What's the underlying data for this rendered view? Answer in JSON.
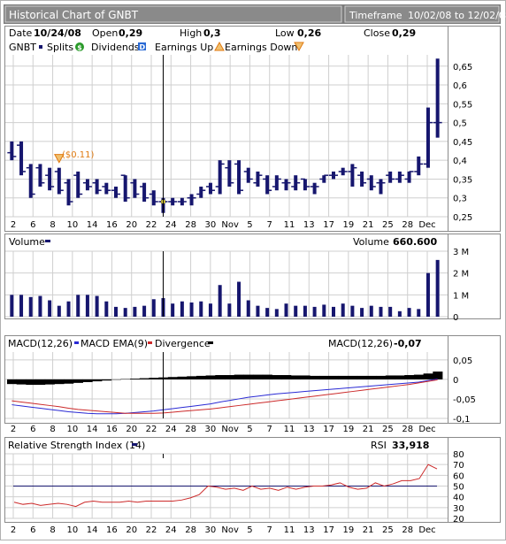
{
  "header": {
    "title": "Historical Chart of GNBT",
    "timeframe_label": "Timeframe",
    "timeframe_range": "10/02/08 to 12/02/08"
  },
  "info": {
    "date_label": "Date",
    "date_value": "10/24/08",
    "open_label": "Open",
    "open_value": "0,29",
    "high_label": "High",
    "high_value": "0,3",
    "low_label": "Low",
    "low_value": "0,26",
    "close_label": "Close",
    "close_value": "0,29"
  },
  "legend": {
    "symbol": "GNBT",
    "splits": "Splits",
    "dividends": "Dividends",
    "earnings_up": "Earnings Up",
    "earnings_down": "Earnings Down"
  },
  "colors": {
    "bar": "#16166e",
    "panel_bg": "#ffffff",
    "grid": "#cfcfcf",
    "frame": "#8a8a8a",
    "header_bg": "#7b7b7b",
    "header_text": "#ffffff",
    "macd_ema": "#2a2ad4",
    "divergence": "#cc2a2a",
    "rsi_line": "#cc2a2a",
    "rsi_ref": "#16166e",
    "earnings": "#e07a10",
    "crosshair": "#000000",
    "highlight": "#f0e040"
  },
  "icons": {
    "dividend": "dollar-circle-icon",
    "earnings_up": "earnings-up-triangle-icon",
    "earnings_down": "earnings-down-triangle-icon",
    "split": "split-square-icon"
  },
  "annotations": {
    "earnings_label": "($0.11)"
  },
  "volume_panel": {
    "label": "Volume",
    "readout_label": "Volume",
    "readout_value": "660.600"
  },
  "macd_panel": {
    "macd_label": "MACD(12,26)",
    "ema_label": "MACD EMA(9)",
    "div_label": "Divergence",
    "readout_label": "MACD(12,26)",
    "readout_value": "-0,07"
  },
  "rsi_panel": {
    "label": "Relative Strength Index (14)",
    "readout_label": "RSI",
    "readout_value": "33,918"
  },
  "chart_data": [
    {
      "type": "ohlc",
      "title": "Historical Chart of GNBT",
      "x_tick_labels": [
        "2",
        "6",
        "8",
        "10",
        "14",
        "16",
        "20",
        "22",
        "24",
        "28",
        "30",
        "Nov",
        "5",
        "7",
        "11",
        "13",
        "17",
        "19",
        "21",
        "25",
        "28",
        "Dec"
      ],
      "ylim": [
        0.25,
        0.68
      ],
      "y_ticks": [
        "0,25",
        "0,3",
        "0,35",
        "0,4",
        "0,45",
        "0,5",
        "0,55",
        "0,6",
        "0,65"
      ],
      "highlight_index": 16,
      "earnings_index": 5,
      "ohlc": [
        {
          "o": 0.42,
          "h": 0.45,
          "l": 0.4,
          "c": 0.41
        },
        {
          "o": 0.44,
          "h": 0.45,
          "l": 0.36,
          "c": 0.37
        },
        {
          "o": 0.38,
          "h": 0.39,
          "l": 0.3,
          "c": 0.31
        },
        {
          "o": 0.38,
          "h": 0.39,
          "l": 0.33,
          "c": 0.34
        },
        {
          "o": 0.36,
          "h": 0.38,
          "l": 0.32,
          "c": 0.33
        },
        {
          "o": 0.37,
          "h": 0.38,
          "l": 0.31,
          "c": 0.32
        },
        {
          "o": 0.34,
          "h": 0.35,
          "l": 0.28,
          "c": 0.29
        },
        {
          "o": 0.36,
          "h": 0.37,
          "l": 0.3,
          "c": 0.31
        },
        {
          "o": 0.34,
          "h": 0.35,
          "l": 0.32,
          "c": 0.33
        },
        {
          "o": 0.34,
          "h": 0.35,
          "l": 0.31,
          "c": 0.32
        },
        {
          "o": 0.33,
          "h": 0.34,
          "l": 0.31,
          "c": 0.32
        },
        {
          "o": 0.32,
          "h": 0.33,
          "l": 0.3,
          "c": 0.31
        },
        {
          "o": 0.36,
          "h": 0.36,
          "l": 0.29,
          "c": 0.3
        },
        {
          "o": 0.34,
          "h": 0.35,
          "l": 0.3,
          "c": 0.31
        },
        {
          "o": 0.33,
          "h": 0.34,
          "l": 0.29,
          "c": 0.3
        },
        {
          "o": 0.31,
          "h": 0.32,
          "l": 0.28,
          "c": 0.29
        },
        {
          "o": 0.29,
          "h": 0.3,
          "l": 0.26,
          "c": 0.29
        },
        {
          "o": 0.29,
          "h": 0.3,
          "l": 0.28,
          "c": 0.29
        },
        {
          "o": 0.29,
          "h": 0.3,
          "l": 0.28,
          "c": 0.29
        },
        {
          "o": 0.3,
          "h": 0.31,
          "l": 0.28,
          "c": 0.3
        },
        {
          "o": 0.31,
          "h": 0.33,
          "l": 0.3,
          "c": 0.32
        },
        {
          "o": 0.33,
          "h": 0.34,
          "l": 0.31,
          "c": 0.32
        },
        {
          "o": 0.33,
          "h": 0.4,
          "l": 0.31,
          "c": 0.39
        },
        {
          "o": 0.38,
          "h": 0.4,
          "l": 0.33,
          "c": 0.34
        },
        {
          "o": 0.39,
          "h": 0.4,
          "l": 0.31,
          "c": 0.32
        },
        {
          "o": 0.37,
          "h": 0.38,
          "l": 0.34,
          "c": 0.35
        },
        {
          "o": 0.34,
          "h": 0.37,
          "l": 0.33,
          "c": 0.36
        },
        {
          "o": 0.35,
          "h": 0.36,
          "l": 0.31,
          "c": 0.32
        },
        {
          "o": 0.33,
          "h": 0.36,
          "l": 0.32,
          "c": 0.35
        },
        {
          "o": 0.34,
          "h": 0.35,
          "l": 0.32,
          "c": 0.34
        },
        {
          "o": 0.33,
          "h": 0.36,
          "l": 0.32,
          "c": 0.34
        },
        {
          "o": 0.35,
          "h": 0.35,
          "l": 0.32,
          "c": 0.33
        },
        {
          "o": 0.33,
          "h": 0.34,
          "l": 0.31,
          "c": 0.33
        },
        {
          "o": 0.35,
          "h": 0.36,
          "l": 0.34,
          "c": 0.36
        },
        {
          "o": 0.36,
          "h": 0.37,
          "l": 0.35,
          "c": 0.36
        },
        {
          "o": 0.37,
          "h": 0.38,
          "l": 0.36,
          "c": 0.37
        },
        {
          "o": 0.37,
          "h": 0.39,
          "l": 0.33,
          "c": 0.38
        },
        {
          "o": 0.36,
          "h": 0.37,
          "l": 0.33,
          "c": 0.34
        },
        {
          "o": 0.35,
          "h": 0.36,
          "l": 0.32,
          "c": 0.33
        },
        {
          "o": 0.34,
          "h": 0.35,
          "l": 0.31,
          "c": 0.34
        },
        {
          "o": 0.36,
          "h": 0.37,
          "l": 0.34,
          "c": 0.35
        },
        {
          "o": 0.35,
          "h": 0.37,
          "l": 0.34,
          "c": 0.36
        },
        {
          "o": 0.35,
          "h": 0.37,
          "l": 0.34,
          "c": 0.37
        },
        {
          "o": 0.37,
          "h": 0.41,
          "l": 0.36,
          "c": 0.39
        },
        {
          "o": 0.39,
          "h": 0.54,
          "l": 0.38,
          "c": 0.5
        },
        {
          "o": 0.5,
          "h": 0.67,
          "l": 0.46,
          "c": 0.5
        }
      ]
    },
    {
      "type": "bar",
      "title": "Volume",
      "ylim": [
        0,
        3
      ],
      "y_ticks": [
        "0",
        "1 M",
        "2 M",
        "3 M"
      ],
      "values": [
        1.0,
        1.0,
        0.9,
        0.95,
        0.75,
        0.5,
        0.7,
        1.0,
        1.0,
        0.95,
        0.7,
        0.45,
        0.4,
        0.45,
        0.5,
        0.8,
        0.85,
        0.6,
        0.7,
        0.65,
        0.7,
        0.6,
        1.45,
        0.6,
        1.6,
        0.75,
        0.5,
        0.4,
        0.35,
        0.6,
        0.5,
        0.5,
        0.45,
        0.55,
        0.45,
        0.6,
        0.5,
        0.4,
        0.5,
        0.45,
        0.45,
        0.25,
        0.4,
        0.35,
        2.0,
        2.6
      ]
    },
    {
      "type": "line",
      "title": "MACD(12,26)",
      "ylim": [
        -0.1,
        0.07
      ],
      "y_ticks": [
        "-0,1",
        "-0,05",
        "0",
        "0,05"
      ],
      "series": [
        {
          "name": "MACD EMA(9)",
          "values": [
            -0.065,
            -0.068,
            -0.071,
            -0.074,
            -0.077,
            -0.08,
            -0.083,
            -0.085,
            -0.087,
            -0.088,
            -0.088,
            -0.088,
            -0.087,
            -0.085,
            -0.083,
            -0.081,
            -0.078,
            -0.075,
            -0.072,
            -0.069,
            -0.066,
            -0.063,
            -0.058,
            -0.054,
            -0.05,
            -0.046,
            -0.043,
            -0.04,
            -0.037,
            -0.035,
            -0.033,
            -0.031,
            -0.029,
            -0.027,
            -0.025,
            -0.023,
            -0.021,
            -0.019,
            -0.017,
            -0.015,
            -0.013,
            -0.011,
            -0.009,
            -0.007,
            -0.003,
            0.001
          ]
        },
        {
          "name": "Divergence",
          "values": [
            -0.055,
            -0.058,
            -0.061,
            -0.064,
            -0.067,
            -0.07,
            -0.074,
            -0.077,
            -0.079,
            -0.081,
            -0.083,
            -0.085,
            -0.087,
            -0.087,
            -0.087,
            -0.087,
            -0.086,
            -0.084,
            -0.082,
            -0.08,
            -0.078,
            -0.076,
            -0.073,
            -0.07,
            -0.067,
            -0.064,
            -0.061,
            -0.058,
            -0.055,
            -0.052,
            -0.049,
            -0.046,
            -0.043,
            -0.04,
            -0.037,
            -0.034,
            -0.031,
            -0.028,
            -0.025,
            -0.022,
            -0.019,
            -0.016,
            -0.013,
            -0.009,
            -0.005,
            -0.001
          ]
        },
        {
          "name": "Histogram",
          "values": [
            -0.012,
            -0.013,
            -0.014,
            -0.014,
            -0.013,
            -0.012,
            -0.011,
            -0.009,
            -0.007,
            -0.005,
            -0.003,
            -0.001,
            0.001,
            0.002,
            0.003,
            0.004,
            0.005,
            0.006,
            0.007,
            0.008,
            0.009,
            0.01,
            0.011,
            0.011,
            0.012,
            0.012,
            0.012,
            0.012,
            0.011,
            0.011,
            0.01,
            0.01,
            0.009,
            0.009,
            0.009,
            0.009,
            0.009,
            0.009,
            0.009,
            0.009,
            0.01,
            0.01,
            0.011,
            0.012,
            0.015,
            0.02
          ]
        }
      ]
    },
    {
      "type": "line",
      "title": "Relative Strength Index (14)",
      "ylim": [
        20,
        80
      ],
      "y_ticks": [
        "20",
        "30",
        "40",
        "50",
        "60",
        "70",
        "80"
      ],
      "reference": 50,
      "series": [
        {
          "name": "RSI",
          "values": [
            35,
            33,
            34,
            32,
            33,
            34,
            33,
            31,
            35,
            36,
            35,
            35,
            35,
            36,
            35,
            36,
            36,
            36,
            36,
            37,
            39,
            42,
            50,
            49,
            47,
            48,
            46,
            50,
            47,
            48,
            46,
            49,
            47,
            49,
            50,
            50,
            51,
            53,
            49,
            47,
            48,
            53,
            50,
            52,
            55,
            55,
            57,
            70,
            66
          ]
        }
      ]
    }
  ]
}
